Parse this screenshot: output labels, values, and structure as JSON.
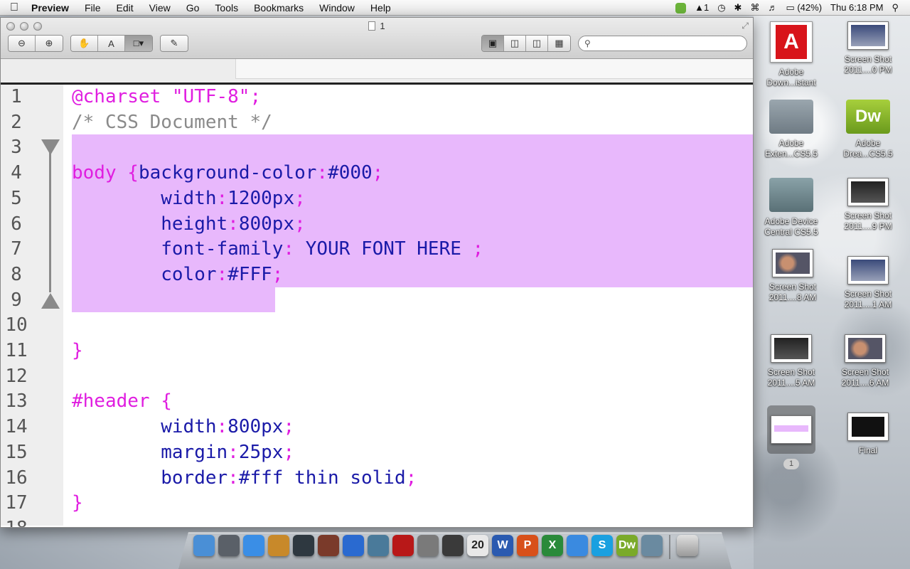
{
  "menubar": {
    "app_name": "Preview",
    "items": [
      "File",
      "Edit",
      "View",
      "Go",
      "Tools",
      "Bookmarks",
      "Window",
      "Help"
    ],
    "status": {
      "adobe_count": "1",
      "battery": "(42%)",
      "clock": "Thu 6:18 PM"
    }
  },
  "window": {
    "title": "1",
    "search_placeholder": ""
  },
  "code": {
    "line_numbers": [
      "1",
      "2",
      "3",
      "4",
      "5",
      "6",
      "7",
      "8",
      "9",
      "10",
      "11",
      "12",
      "13",
      "14",
      "15",
      "16",
      "17",
      "18"
    ],
    "lines": [
      [
        "@charset \"UTF-8\";"
      ],
      [
        "/* CSS Document */"
      ],
      [
        ""
      ],
      [
        "body {",
        "background-color",
        ":",
        "#000",
        ";"
      ],
      [
        "        ",
        "width",
        ":",
        "1200px",
        ";"
      ],
      [
        "        ",
        "height",
        ":",
        "800px",
        ";"
      ],
      [
        "        ",
        "font-family",
        ":",
        " YOUR FONT HERE ",
        ";"
      ],
      [
        "        ",
        "color",
        ":",
        "#FFF",
        ";"
      ],
      [
        ""
      ],
      [
        ""
      ],
      [
        "}"
      ],
      [
        ""
      ],
      [
        "#header {"
      ],
      [
        "        ",
        "width",
        ":",
        "800px",
        ";"
      ],
      [
        "        ",
        "margin",
        ":",
        "25px",
        ";"
      ],
      [
        "        ",
        "border",
        ":",
        "#fff thin solid",
        ";"
      ],
      [
        "}"
      ],
      [
        ""
      ]
    ]
  },
  "desktop": {
    "icons": [
      {
        "label": "Adobe Down...istant",
        "kind": "adobe"
      },
      {
        "label": "Screen Shot 2011....0 PM",
        "kind": "thumb"
      },
      {
        "label": "Adobe Exten...CS5.5",
        "kind": "folder-grey"
      },
      {
        "label": "Adobe Drea...CS5.5",
        "kind": "folder-dw",
        "glyph": "Dw"
      },
      {
        "label": "Adobe Device Central CS5.5",
        "kind": "folder-teal"
      },
      {
        "label": "Screen Shot 2011....9 PM",
        "kind": "thumb"
      },
      {
        "label": "Screen Shot 2011....8 AM",
        "kind": "thumb"
      },
      {
        "label": "Screen Shot 2011....1 AM",
        "kind": "thumb"
      },
      {
        "label": "Screen Shot 2011....5 AM",
        "kind": "thumb"
      },
      {
        "label": "Screen Shot 2011....6 AM",
        "kind": "thumb"
      },
      {
        "label": "1",
        "kind": "selected"
      },
      {
        "label": "Final",
        "kind": "final"
      }
    ]
  },
  "dock": {
    "calendar_day": "20",
    "items": [
      {
        "name": "finder",
        "color": "#4a8fd6"
      },
      {
        "name": "launchpad",
        "color": "#5a6068"
      },
      {
        "name": "safari",
        "color": "#3a8ee6"
      },
      {
        "name": "garageband",
        "color": "#c8892a"
      },
      {
        "name": "facetime",
        "color": "#2e3840"
      },
      {
        "name": "photo-booth",
        "color": "#7a3a2a"
      },
      {
        "name": "itunes",
        "color": "#2a6ad0"
      },
      {
        "name": "iphoto",
        "color": "#4a7a9a"
      },
      {
        "name": "photo-booth-red",
        "color": "#b81818"
      },
      {
        "name": "system-preferences",
        "color": "#7a7a7a"
      },
      {
        "name": "imovie",
        "color": "#3a3a3a"
      },
      {
        "name": "calendar",
        "color": "#e8e8e8"
      },
      {
        "name": "word",
        "color": "#2a5ab0",
        "glyph": "W"
      },
      {
        "name": "powerpoint",
        "color": "#d8501a",
        "glyph": "P"
      },
      {
        "name": "excel",
        "color": "#2a8a3a",
        "glyph": "X"
      },
      {
        "name": "app-store",
        "color": "#3a8ae0"
      },
      {
        "name": "skype",
        "color": "#1aa0e0",
        "glyph": "S"
      },
      {
        "name": "dreamweaver",
        "color": "#7aaa2a",
        "glyph": "Dw"
      },
      {
        "name": "preview",
        "color": "#6a8aa0"
      }
    ]
  }
}
